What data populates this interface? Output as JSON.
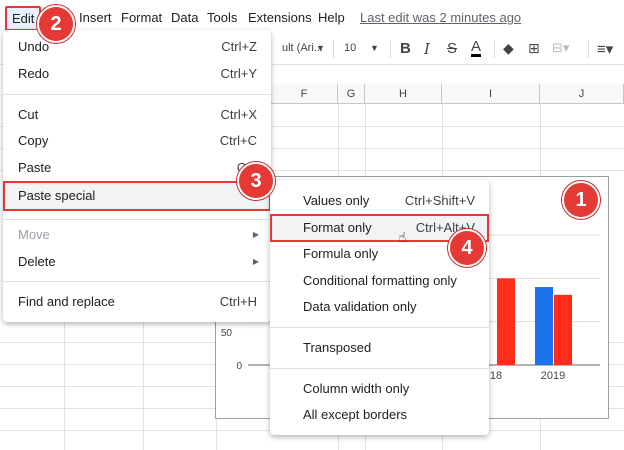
{
  "menubar": {
    "items": [
      "Edit",
      "Insert",
      "Format",
      "Data",
      "Tools",
      "Extensions",
      "Help"
    ],
    "last_edit": "Last edit was 2 minutes ago"
  },
  "toolbar": {
    "font": "ult (Ari...",
    "font_size": "10",
    "bold": "B",
    "italic": "I",
    "strike": "S",
    "text_color": "A"
  },
  "columns": [
    "F",
    "G",
    "H",
    "I",
    "J"
  ],
  "edit_menu": {
    "items": [
      {
        "label": "Undo",
        "shortcut": "Ctrl+Z"
      },
      {
        "label": "Redo",
        "shortcut": "Ctrl+Y"
      },
      {
        "label": "Cut",
        "shortcut": "Ctrl+X"
      },
      {
        "label": "Copy",
        "shortcut": "Ctrl+C"
      },
      {
        "label": "Paste",
        "shortcut": "Ctrl"
      },
      {
        "label": "Paste special",
        "shortcut": ""
      },
      {
        "label": "Move",
        "shortcut": ""
      },
      {
        "label": "Delete",
        "shortcut": ""
      },
      {
        "label": "Find and replace",
        "shortcut": "Ctrl+H"
      }
    ]
  },
  "paste_special_menu": {
    "items": [
      {
        "label": "Values only",
        "shortcut": "Ctrl+Shift+V"
      },
      {
        "label": "Format only",
        "shortcut": "Ctrl+Alt+V"
      },
      {
        "label": "Formula only",
        "shortcut": ""
      },
      {
        "label": "Conditional formatting only",
        "shortcut": ""
      },
      {
        "label": "Data validation only",
        "shortcut": ""
      },
      {
        "label": "Transposed",
        "shortcut": ""
      },
      {
        "label": "Column width only",
        "shortcut": ""
      },
      {
        "label": "All except borders",
        "shortcut": ""
      }
    ]
  },
  "badges": [
    "1",
    "2",
    "3",
    "4"
  ],
  "chart_data": {
    "type": "bar",
    "categories": [
      "18",
      "2019"
    ],
    "series": [
      {
        "values": [
          null,
          90
        ]
      },
      {
        "values": [
          100,
          81
        ]
      }
    ],
    "colors": [
      "#1a73e8",
      "#ff2d1a"
    ],
    "y_ticks": [
      "50",
      "0"
    ],
    "ylim": [
      0,
      150
    ]
  },
  "colors": {
    "highlight_border": "#e53935",
    "badge": "#e53935",
    "edit_active_bg": "#e8f0fe"
  }
}
